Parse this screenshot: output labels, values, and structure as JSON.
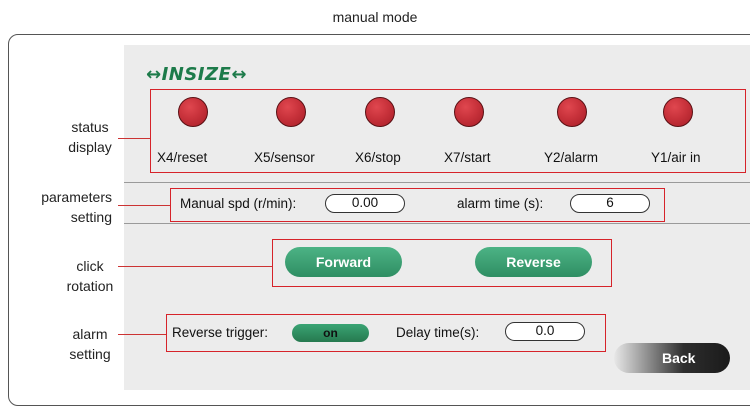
{
  "window": {
    "title": "manual mode"
  },
  "brand": {
    "logo_text": "↔INSIZE↔",
    "color": "#1d7b4a"
  },
  "callouts": {
    "status": [
      "status",
      "display"
    ],
    "parameters": [
      "parameters",
      "setting"
    ],
    "rotation": [
      "click",
      "rotation"
    ],
    "alarm": [
      "alarm",
      "setting"
    ]
  },
  "status_lamps": [
    {
      "label": "X4/reset",
      "state": "red"
    },
    {
      "label": "X5/sensor",
      "state": "red"
    },
    {
      "label": "X6/stop",
      "state": "red"
    },
    {
      "label": "X7/start",
      "state": "red"
    },
    {
      "label": "Y2/alarm",
      "state": "red"
    },
    {
      "label": "Y1/air in",
      "state": "red"
    }
  ],
  "parameters": {
    "manual_spd_label": "Manual spd (r/min):",
    "manual_spd_value": "0.00",
    "alarm_time_label": "alarm time (s):",
    "alarm_time_value": "6"
  },
  "rotation": {
    "forward_label": "Forward",
    "reverse_label": "Reverse"
  },
  "alarm_setting": {
    "reverse_trigger_label": "Reverse trigger:",
    "reverse_trigger_state": "on",
    "delay_time_label": "Delay time(s):",
    "delay_time_value": "0.0"
  },
  "nav": {
    "back_label": "Back"
  },
  "colors": {
    "highlight": "#d6232a",
    "button_green": "#3a9f72",
    "lamp_red": "#c8323b"
  }
}
